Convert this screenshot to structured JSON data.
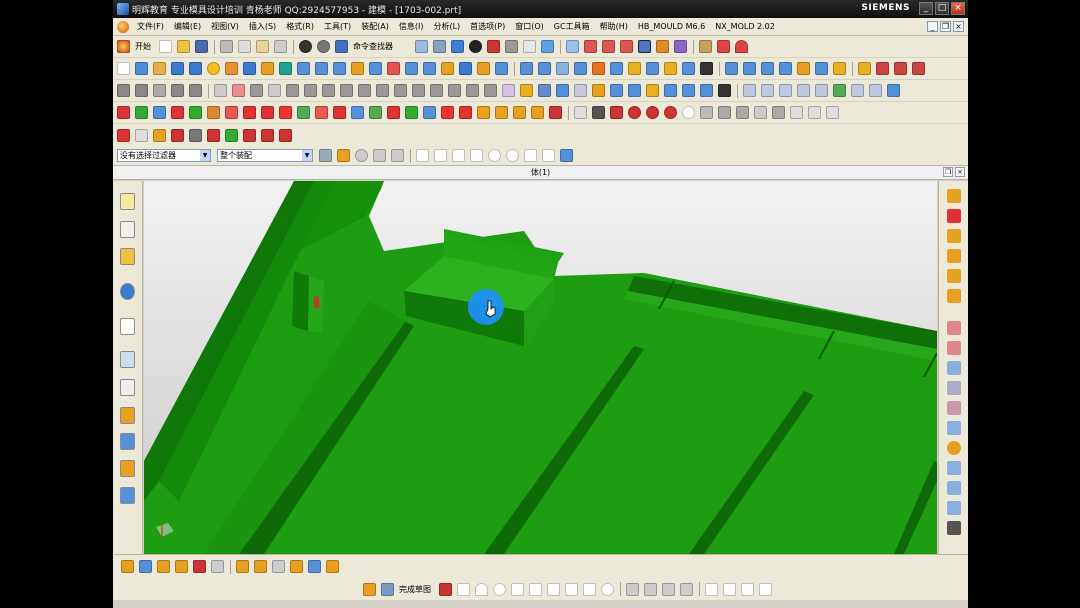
{
  "window": {
    "title": "明辉教育 专业模具设计培训 青杨老师  QQ:2924577953 - 建模 - [1703-002.prt]",
    "brand": "SIEMENS",
    "minimize": "_",
    "maximize": "□",
    "close": "×"
  },
  "menubar": {
    "items": [
      "文件(F)",
      "编辑(E)",
      "视图(V)",
      "插入(S)",
      "格式(R)",
      "工具(T)",
      "装配(A)",
      "信息(I)",
      "分析(L)",
      "首选项(P)",
      "窗口(O)",
      "GC工具箱",
      "帮助(H)",
      "HB_MOULD M6.6",
      "NX_MOLD 2.02"
    ]
  },
  "toolbar": {
    "start_label": "开始",
    "command_finder_label": "命令查找器"
  },
  "filterbar": {
    "selection_filter": "没有选择过滤器",
    "assembly_scope": "整个装配"
  },
  "document": {
    "name": "体(1)"
  },
  "sketch_bar": {
    "finish_sketch_label": "完成草图"
  },
  "colors": {
    "model_green": "#1a9b0d",
    "model_dark_green": "#0d6a06",
    "cursor_highlight": "#1e90ff",
    "title_bar": "#1a1a1a"
  },
  "icons": {
    "left_toolbar": [
      "assembly-navigator-icon",
      "constraint-navigator-icon",
      "part-navigator-icon",
      "reuse-library-icon",
      "hd3d-tools-icon",
      "history-icon",
      "system-materials-icon",
      "process-studio-icon",
      "manufacturing-wizard-icon",
      "roles-icon",
      "system-scenes-icon"
    ],
    "right_toolbar": [
      "mold-wizard-icon",
      "mold-tools-icon",
      "parting-icon",
      "mold-base-icon",
      "standard-part-icon",
      "ejector-pin-icon"
    ]
  }
}
